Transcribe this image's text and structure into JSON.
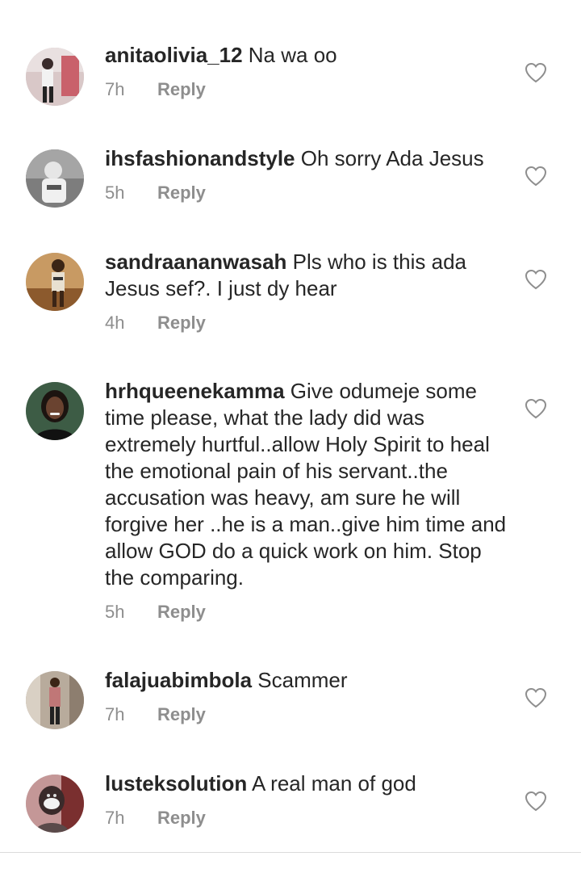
{
  "comments": [
    {
      "username": "anitaolivia_12",
      "text": "Na wa oo",
      "time": "7h",
      "reply_label": "Reply",
      "avatar_color": "#c9a8a8"
    },
    {
      "username": "ihsfashionandstyle",
      "text": "Oh sorry Ada Jesus",
      "time": "5h",
      "reply_label": "Reply",
      "avatar_color": "#9a9a9a"
    },
    {
      "username": "sandraananwasah",
      "text": "Pls who is this ada Jesus sef?. I just dy hear",
      "time": "4h",
      "reply_label": "Reply",
      "avatar_color": "#b58a57"
    },
    {
      "username": "hrhqueenekamma",
      "text": "Give odumeje some time please, what the lady did was extremely hurtful..allow Holy Spirit to heal the emotional pain of his servant..the accusation was heavy, am sure he will forgive her ..he is a man..give him time and allow GOD do a quick work on him. Stop the comparing.",
      "time": "5h",
      "reply_label": "Reply",
      "avatar_color": "#2f4a35"
    },
    {
      "username": "falajuabimbola",
      "text": "Scammer",
      "time": "7h",
      "reply_label": "Reply",
      "avatar_color": "#a7978a"
    },
    {
      "username": "lusteksolution",
      "text": "A real man of god",
      "time": "7h",
      "reply_label": "Reply",
      "avatar_color": "#b98080"
    }
  ],
  "icons": {
    "like": "heart-outline-icon",
    "avatar": "profile-picture"
  },
  "colors": {
    "text": "#262626",
    "muted": "#8e8e8e",
    "icon": "#8e8e8e",
    "divider": "#dbdbdb"
  }
}
